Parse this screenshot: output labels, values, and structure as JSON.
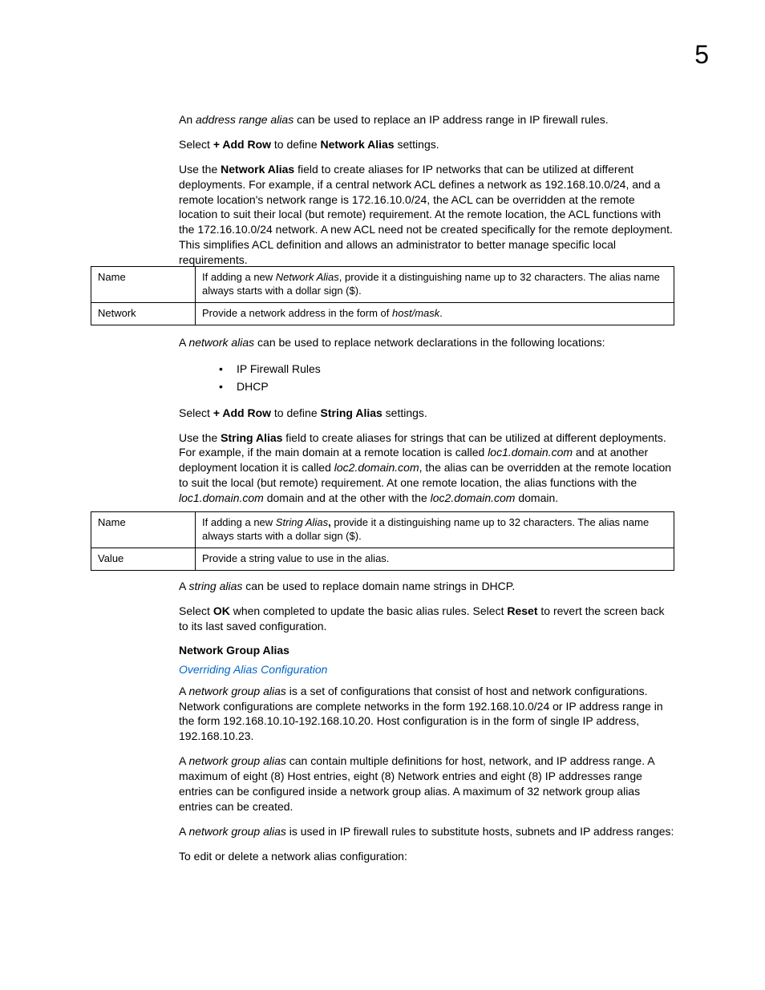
{
  "pageNumber": "5",
  "para1": {
    "prefix": "An ",
    "italic": "address range alias",
    "suffix": " can be used to replace an IP address range in IP firewall rules."
  },
  "para2": {
    "p1": "Select ",
    "b1": "+ Add Row",
    "p2": " to define ",
    "b2": "Network Alias",
    "p3": " settings."
  },
  "para3": {
    "p1": "Use the ",
    "b1": "Network Alias",
    "p2": " field to create aliases for IP networks that can be utilized at different deployments. For example, if a central network ACL defines a network as 192.168.10.0/24, and a remote location's network range is 172.16.10.0/24, the ACL can be overridden at the remote location to suit their local (but remote) requirement. At the remote location, the ACL functions with the 172.16.10.0/24 network. A new ACL need not be created specifically for the remote deployment. This simplifies ACL definition and allows an administrator to better manage specific local requirements."
  },
  "table1": {
    "r1label": "Name",
    "r1val": {
      "p1": "If adding a new ",
      "i1": "Network Alias",
      "p2": ", provide it a distinguishing name up to 32 characters. The alias name always starts with a dollar sign ($)."
    },
    "r2label": "Network",
    "r2val": {
      "p1": "Provide a network address in the form of ",
      "i1": "host/mask",
      "p2": "."
    }
  },
  "para4": {
    "p1": "A ",
    "i1": "network alias",
    "p2": " can be used to replace network declarations in the following locations:"
  },
  "list1": {
    "item1": "IP Firewall Rules",
    "item2": "DHCP"
  },
  "para5": {
    "p1": "Select ",
    "b1": "+ Add Row",
    "p2": " to define ",
    "b2": "String Alias",
    "p3": " settings."
  },
  "para6": {
    "p1": "Use the ",
    "b1": "String Alias",
    "p2": " field to create aliases for strings that can be utilized at different deployments. For example, if the main domain at a remote location is called ",
    "i1": "loc1.domain.com",
    "p3": " and at another deployment location it is called ",
    "i2": "loc2.domain.com",
    "p4": ", the alias can be overridden at the remote location to suit the local (but remote) requirement. At one remote location, the alias functions with the ",
    "i3": "loc1.domain.com",
    "p5": " domain and at the other with the ",
    "i4": "loc2.domain.com",
    "p6": " domain."
  },
  "table2": {
    "r1label": "Name",
    "r1val": {
      "p1": "If adding a new ",
      "i1": "String Alias",
      "b1": ",",
      "p2": " provide it a distinguishing name up to 32 characters. The alias name always starts with a dollar sign ($)."
    },
    "r2label": "Value",
    "r2val": "Provide a string value to use in the alias."
  },
  "para7": {
    "p1": "A ",
    "i1": "string alias",
    "p2": " can be used to replace domain name strings in DHCP."
  },
  "para8": {
    "p1": "Select ",
    "b1": "OK",
    "p2": " when completed to update the basic alias rules. Select ",
    "b2": "Reset",
    "p3": " to revert the screen back to its last saved configuration."
  },
  "heading1": "Network Group Alias",
  "link1": "Overriding Alias Configuration",
  "para9": {
    "p1": "A ",
    "i1": "network group alias",
    "p2": " is a set of configurations that consist of host and network configurations. Network configurations are complete networks in the form 192.168.10.0/24 or IP address range in the form 192.168.10.10-192.168.10.20. Host configuration is in the form of single IP address, 192.168.10.23."
  },
  "para10": {
    "p1": "A ",
    "i1": "network group alias",
    "p2": " can contain multiple definitions for host, network, and IP address range. A maximum of eight (8) Host entries, eight (8) Network entries and eight (8) IP addresses range entries can be configured inside a network group alias. A maximum of 32 network group alias entries can be created."
  },
  "para11": {
    "p1": "A ",
    "i1": "network group alias",
    "p2": " is used in IP firewall rules to substitute hosts, subnets and IP address ranges:"
  },
  "para12": "To edit or delete a network alias configuration:"
}
